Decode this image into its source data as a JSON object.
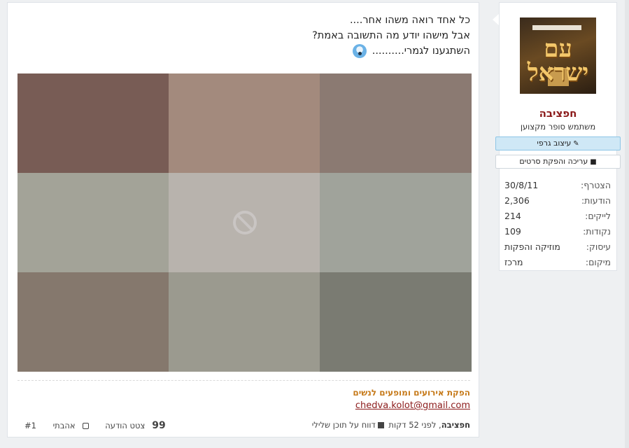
{
  "post": {
    "lines": [
      "כל אחד רואה משהו אחר....",
      "אבל מישהו יודע מה התשובה באמת?",
      "השתגענו לגמרי.........."
    ],
    "emoji_icon": "screaming-face-emoji",
    "image_cells": [
      "#785c55",
      "#a38a7d",
      "#8b7a72",
      "#a3a398",
      "#b8b3ad",
      "#a0a39b",
      "#85786d",
      "#9b9a8f",
      "#7a7b72"
    ],
    "blocked_icon": "blocked-image-icon"
  },
  "signature": {
    "title": "הפקת אירועים ומופעים לנשים",
    "email": "chedva.kolot@gmail.com"
  },
  "footer": {
    "author": "חפציבה",
    "time": ", לפני 52 דקות",
    "report_label": "דווח על תוכן שלילי",
    "post_number": "#1",
    "like_label": "אהבתי",
    "quote_label": "צטט הודעה"
  },
  "user": {
    "avatar_text": "עם ישראל",
    "name": "חפציבה",
    "title": "משתמש סופר מקצוען",
    "badges": [
      {
        "label": "עיצוב גרפי",
        "icon": "pencil-icon"
      },
      {
        "label": "עריכה והפקת סרטים",
        "icon": "video-camera-icon"
      }
    ],
    "stats": [
      {
        "key": "הצטרף:",
        "value": "30/8/11"
      },
      {
        "key": "הודעות:",
        "value": "2,306"
      },
      {
        "key": "לייקים:",
        "value": "214"
      },
      {
        "key": "נקודות:",
        "value": "109"
      },
      {
        "key": "עיסוק:",
        "value": "מוזיקה והפקות"
      },
      {
        "key": "מיקום:",
        "value": "מרכז"
      }
    ]
  },
  "colors": {
    "username": "#8b1a1a",
    "signature_title": "#c67a1a",
    "active_badge": "#cfe8f6"
  }
}
